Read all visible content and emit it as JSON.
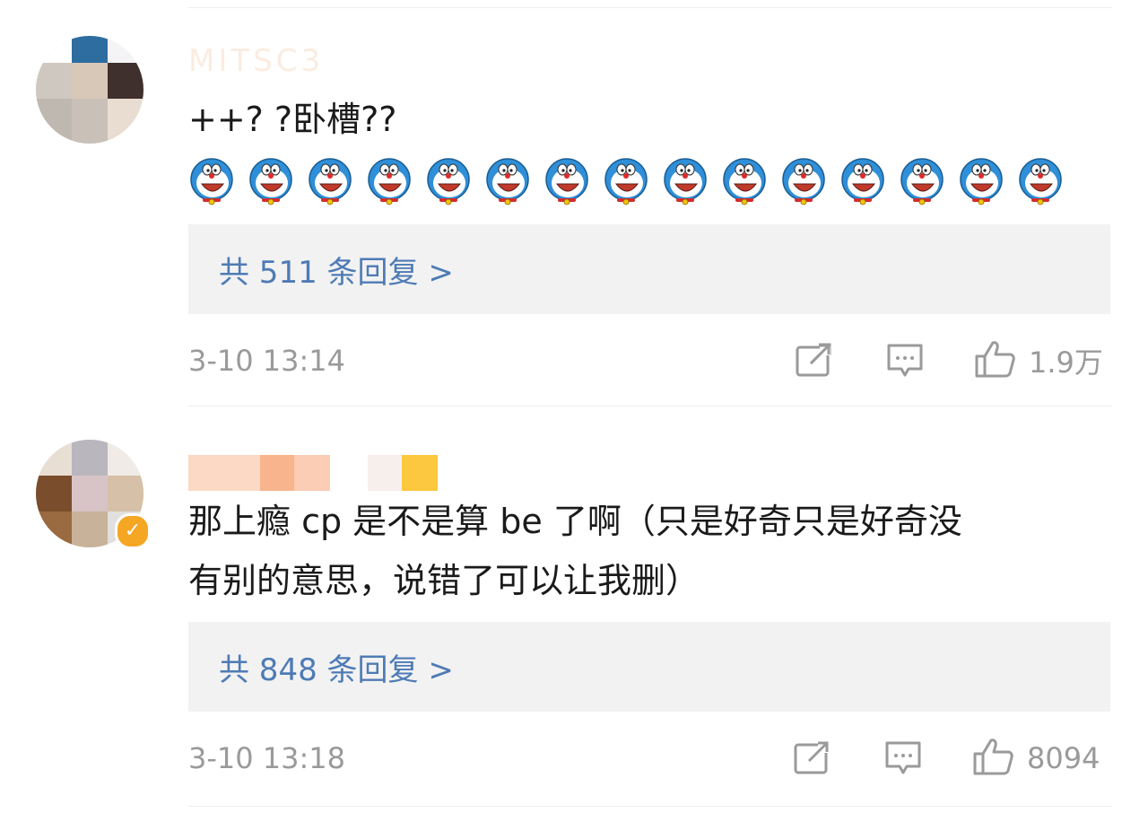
{
  "colors": {
    "link": "#4e7bb5",
    "muted": "#9a9a9a",
    "reply_bg": "#f2f2f2",
    "verified": "#f5a623",
    "emoji_blue": "#2f8fd8"
  },
  "comments": [
    {
      "username": "MITSC3",
      "text": "++? ?卧槽??",
      "emoji_name": "doraemon-emoji",
      "emoji_count": 15,
      "replies_label": "共 511 条回复 >",
      "time": "3-10 13:14",
      "likes": "1.9万"
    },
    {
      "text_line1": "那上瘾 cp 是不是算 be 了啊（只是好奇只是好奇没",
      "text_line2": "有别的意思，说错了可以让我删）",
      "verified_icon": "✓",
      "replies_label": "共 848 条回复 >",
      "time": "3-10 13:18",
      "likes": "8094"
    }
  ],
  "icons": {
    "share": "share-icon",
    "comment": "comment-icon",
    "like": "thumbs-up-icon",
    "verified": "verified-badge-icon"
  }
}
